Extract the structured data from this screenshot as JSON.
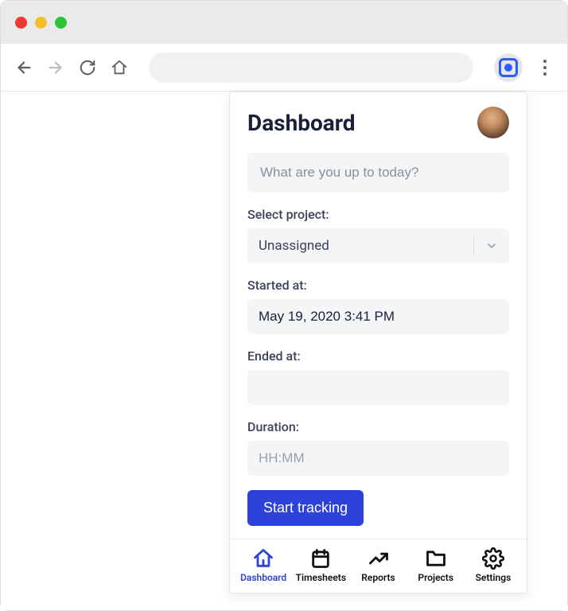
{
  "popup": {
    "title": "Dashboard",
    "task_placeholder": "What are you up to today?",
    "project": {
      "label": "Select project:",
      "selected": "Unassigned"
    },
    "started": {
      "label": "Started at:",
      "value": "May 19, 2020 3:41 PM"
    },
    "ended": {
      "label": "Ended at:",
      "value": ""
    },
    "duration": {
      "label": "Duration:",
      "placeholder": "HH:MM",
      "value": ""
    },
    "start_button": "Start tracking"
  },
  "tabs": {
    "dashboard": "Dashboard",
    "timesheets": "Timesheets",
    "reports": "Reports",
    "projects": "Projects",
    "settings": "Settings"
  }
}
